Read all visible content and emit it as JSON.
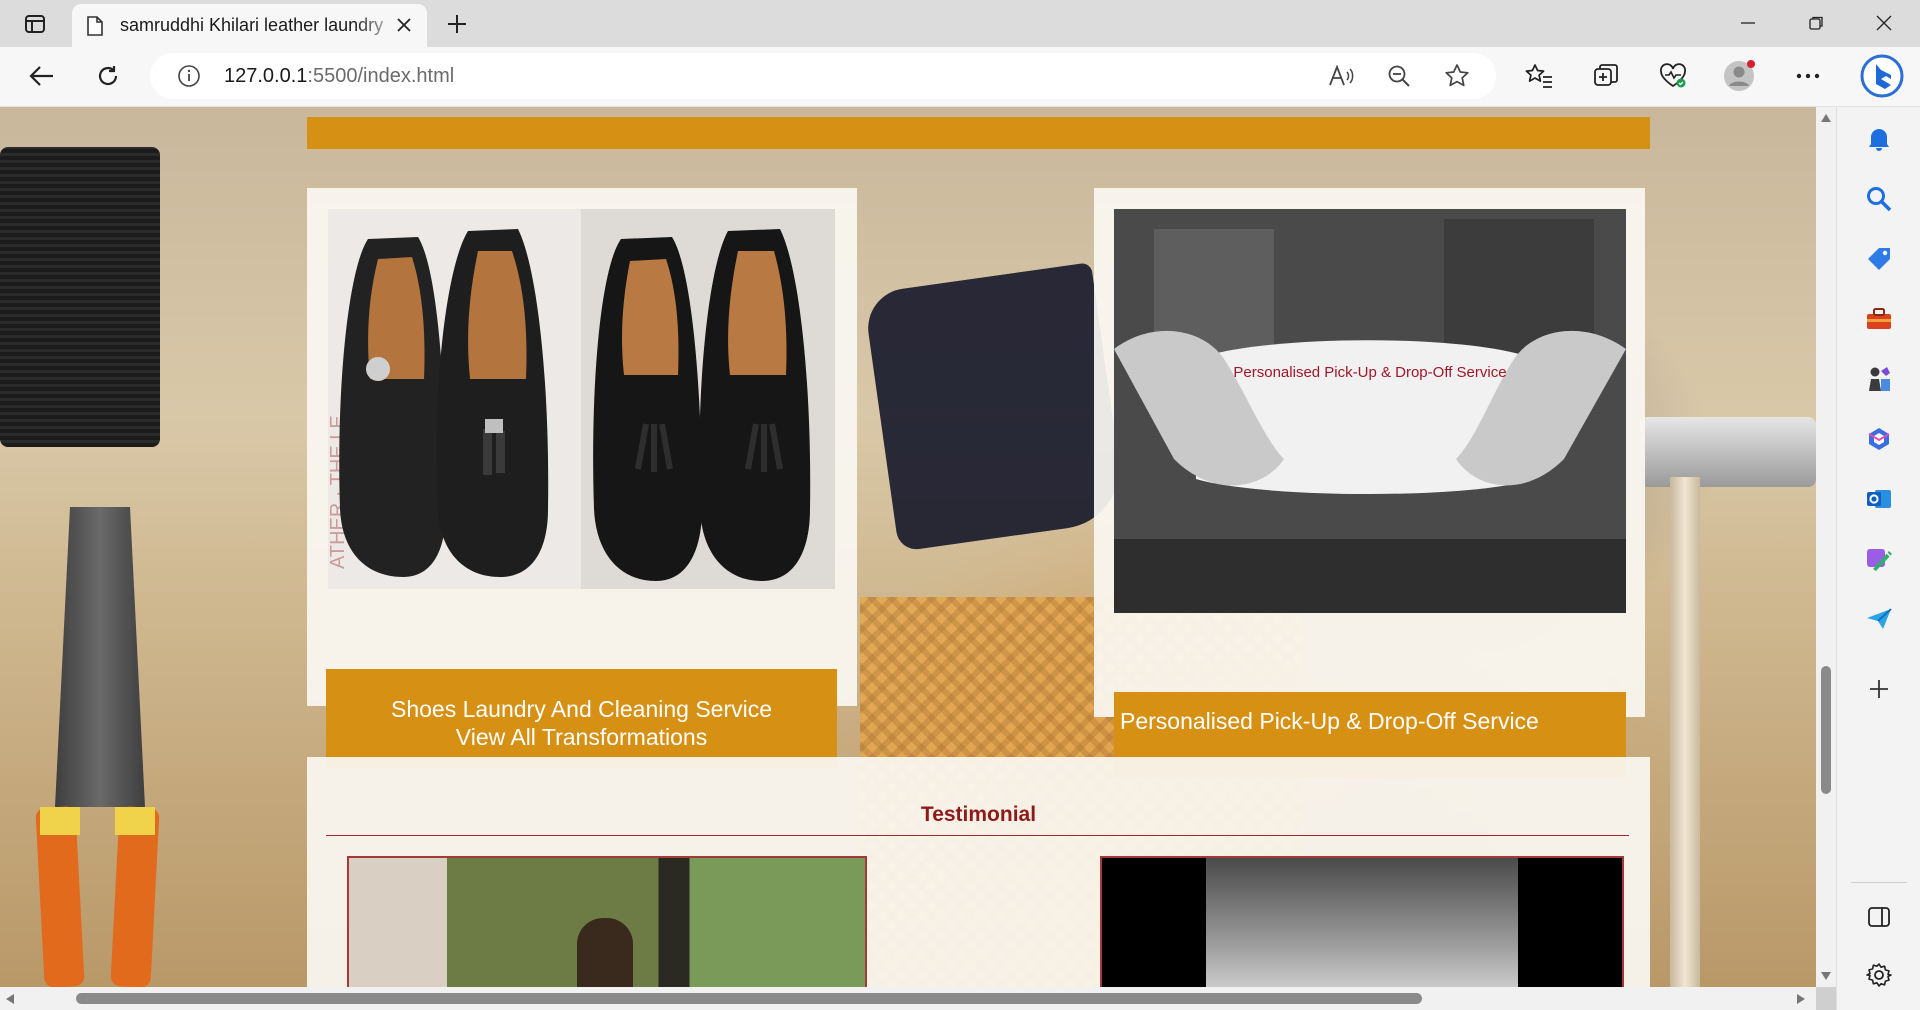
{
  "browser": {
    "tab_title": "samruddhi Khilari leather laundry",
    "url_host": "127.0.0.1",
    "url_rest": ":5500/index.html"
  },
  "page": {
    "service_cards": [
      {
        "caption_line1": "Shoes Laundry And Cleaning Service",
        "caption_line2": "View All Transformations"
      },
      {
        "image_overlay_text": "Personalised Pick-Up & Drop-Off Service",
        "caption": "Personalised Pick-Up & Drop-Off Service"
      }
    ],
    "testimonial_heading": "Testimonial"
  },
  "colors": {
    "accent_gold": "#d69014",
    "testimonial_red": "#8f1a1a",
    "overlay_red": "#a3162a"
  },
  "icons": {
    "toolbar": [
      "back-icon",
      "refresh-icon",
      "info-icon",
      "read-aloud-icon",
      "zoom-out-icon",
      "favorite-star-icon",
      "favorites-icon",
      "collections-icon",
      "browser-essentials-icon",
      "profile-icon",
      "more-icon",
      "bing-copilot-icon"
    ],
    "sidebar": [
      "bell-icon",
      "search-icon",
      "tag-icon",
      "toolbox-icon",
      "games-icon",
      "microsoft365-icon",
      "outlook-icon",
      "designer-icon",
      "send-icon",
      "add-icon",
      "split-screen-icon",
      "settings-icon"
    ]
  }
}
